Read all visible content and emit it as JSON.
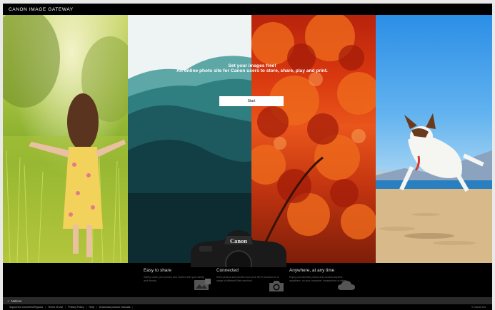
{
  "header": {
    "brand": "CANON IMAGE GATEWAY"
  },
  "hero": {
    "headline": "Set your images free!",
    "subheadline": "An online photo site for Canon users to store, share, play and print.",
    "start_label": "Start",
    "camera_brand": "Canon"
  },
  "features": [
    {
      "title": "Easy to share",
      "description": "Safely share your photos and movies with your family and friends.",
      "icon": "photo-share-icon"
    },
    {
      "title": "Connected",
      "description": "Send photos and movies from your Wi-Fi products to a range of different Web services.",
      "icon": "camera-icon"
    },
    {
      "title": "Anywhere, at any time",
      "description": "Enjoy your favorite photos and movies anytime, anywhere, on your computer, smartphone or tablet.",
      "icon": "cloud-icon"
    }
  ],
  "notices": {
    "label": "Notices"
  },
  "footer": {
    "links": [
      "Supported Countries/Regions",
      "Terms of Use",
      "Privacy Policy",
      "Help",
      "Download product manuals"
    ],
    "copyright": "© Canon Inc."
  },
  "colors": {
    "background": "#000000",
    "button_bg": "#ffffff",
    "notices_bar": "#2a2a2a"
  }
}
